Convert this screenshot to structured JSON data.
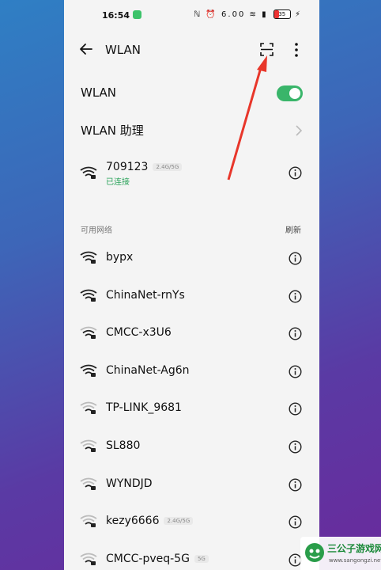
{
  "status_bar": {
    "time": "16:54",
    "net_speed": "6.00",
    "battery": "35"
  },
  "header": {
    "title": "WLAN"
  },
  "wlan_toggle": {
    "label": "WLAN",
    "enabled": true
  },
  "assistant": {
    "label": "WLAN 助理"
  },
  "connected": {
    "name": "709123",
    "band": "2.4G/5G",
    "status": "已连接"
  },
  "available": {
    "title": "可用网络",
    "refresh_label": "刷新",
    "networks": [
      {
        "name": "bypx",
        "band": "",
        "signal": "strong"
      },
      {
        "name": "ChinaNet-rnYs",
        "band": "",
        "signal": "strong"
      },
      {
        "name": "CMCC-x3U6",
        "band": "",
        "signal": "medium"
      },
      {
        "name": "ChinaNet-Ag6n",
        "band": "",
        "signal": "strong"
      },
      {
        "name": "TP-LINK_9681",
        "band": "",
        "signal": "weak"
      },
      {
        "name": "SL880",
        "band": "",
        "signal": "weak"
      },
      {
        "name": "WYNDJD",
        "band": "",
        "signal": "weak"
      },
      {
        "name": "kezy6666",
        "band": "2.4G/5G",
        "signal": "weak"
      },
      {
        "name": "CMCC-pveq-5G",
        "band": "5G",
        "signal": "weak"
      }
    ]
  },
  "watermark": {
    "title": "三公子游戏网",
    "url": "www.sangongzi.net"
  },
  "colors": {
    "accent": "#39b56a",
    "connected_status": "#2aa35a",
    "arrow": "#e8362a"
  }
}
